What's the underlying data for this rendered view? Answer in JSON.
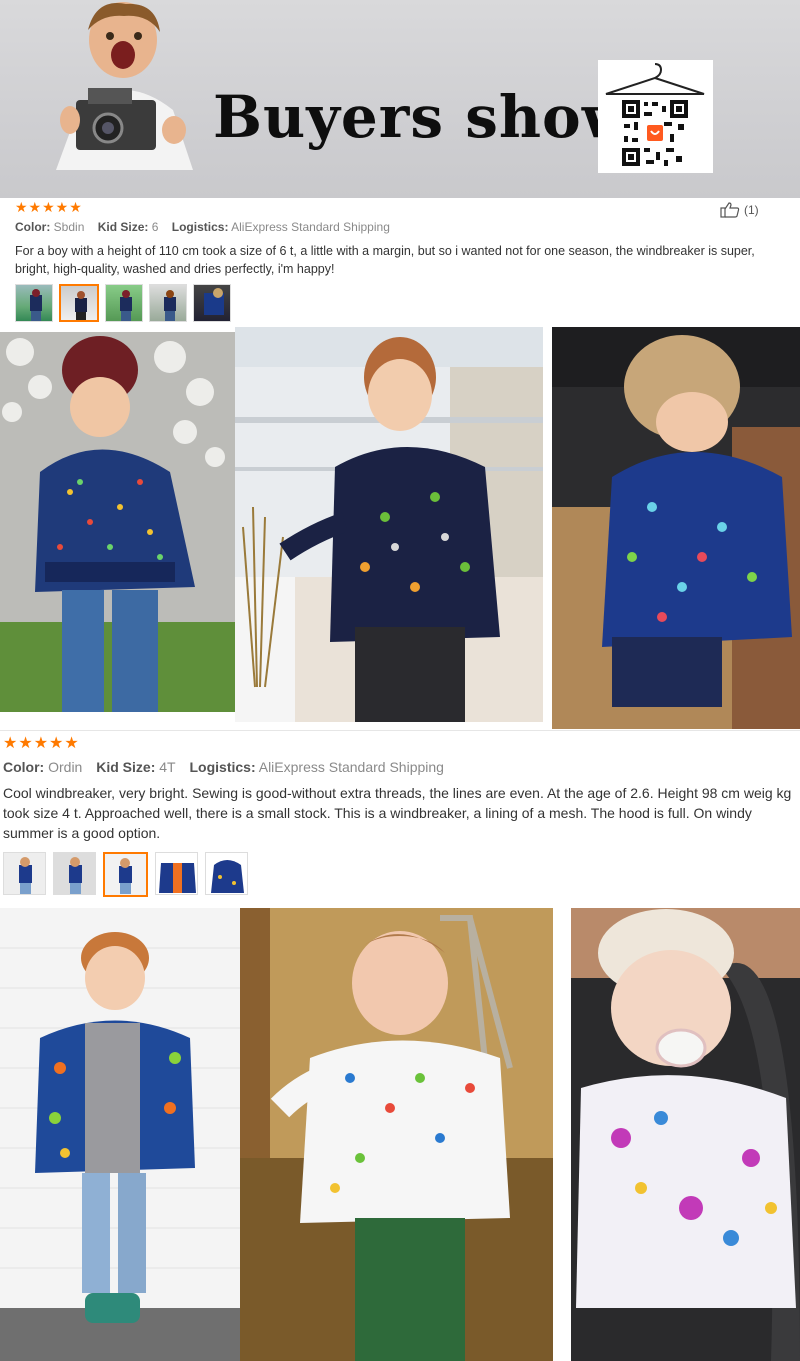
{
  "banner": {
    "title": "Buyers show",
    "qr_label": "qr-code"
  },
  "colors": {
    "star": "#ff7a00",
    "selected_border": "#ff7a00"
  },
  "reviews": [
    {
      "stars": "★★★★★",
      "color_label": "Color:",
      "color_value": "Sbdin",
      "size_label": "Kid Size:",
      "size_value": "6",
      "logistics_label": "Logistics:",
      "logistics_value": "AliExpress Standard Shipping",
      "helpful_count": "(1)",
      "text": "For a boy with a height of 110 cm took a size of 6 t, a little with a margin, but so i wanted not for one season, the windbreaker is super, bright, high-quality, washed and dries perfectly, i'm happy!",
      "thumbnail_count": 5,
      "selected_thumbnail": 2
    },
    {
      "stars": "★★★★★",
      "color_label": "Color:",
      "color_value": "Ordin",
      "size_label": "Kid Size:",
      "size_value": "4T",
      "logistics_label": "Logistics:",
      "logistics_value": "AliExpress Standard Shipping",
      "text": "Cool windbreaker, very bright. Sewing is good-without extra threads, the lines are even. At the age of 2.6. Height 98 cm weig kg took size 4 t. Approached well, there is a small stock. This is a windbreaker, a lining of a mesh. The hood is full. On windy summer is a good option.",
      "thumbnail_count": 5,
      "selected_thumbnail": 3
    }
  ]
}
